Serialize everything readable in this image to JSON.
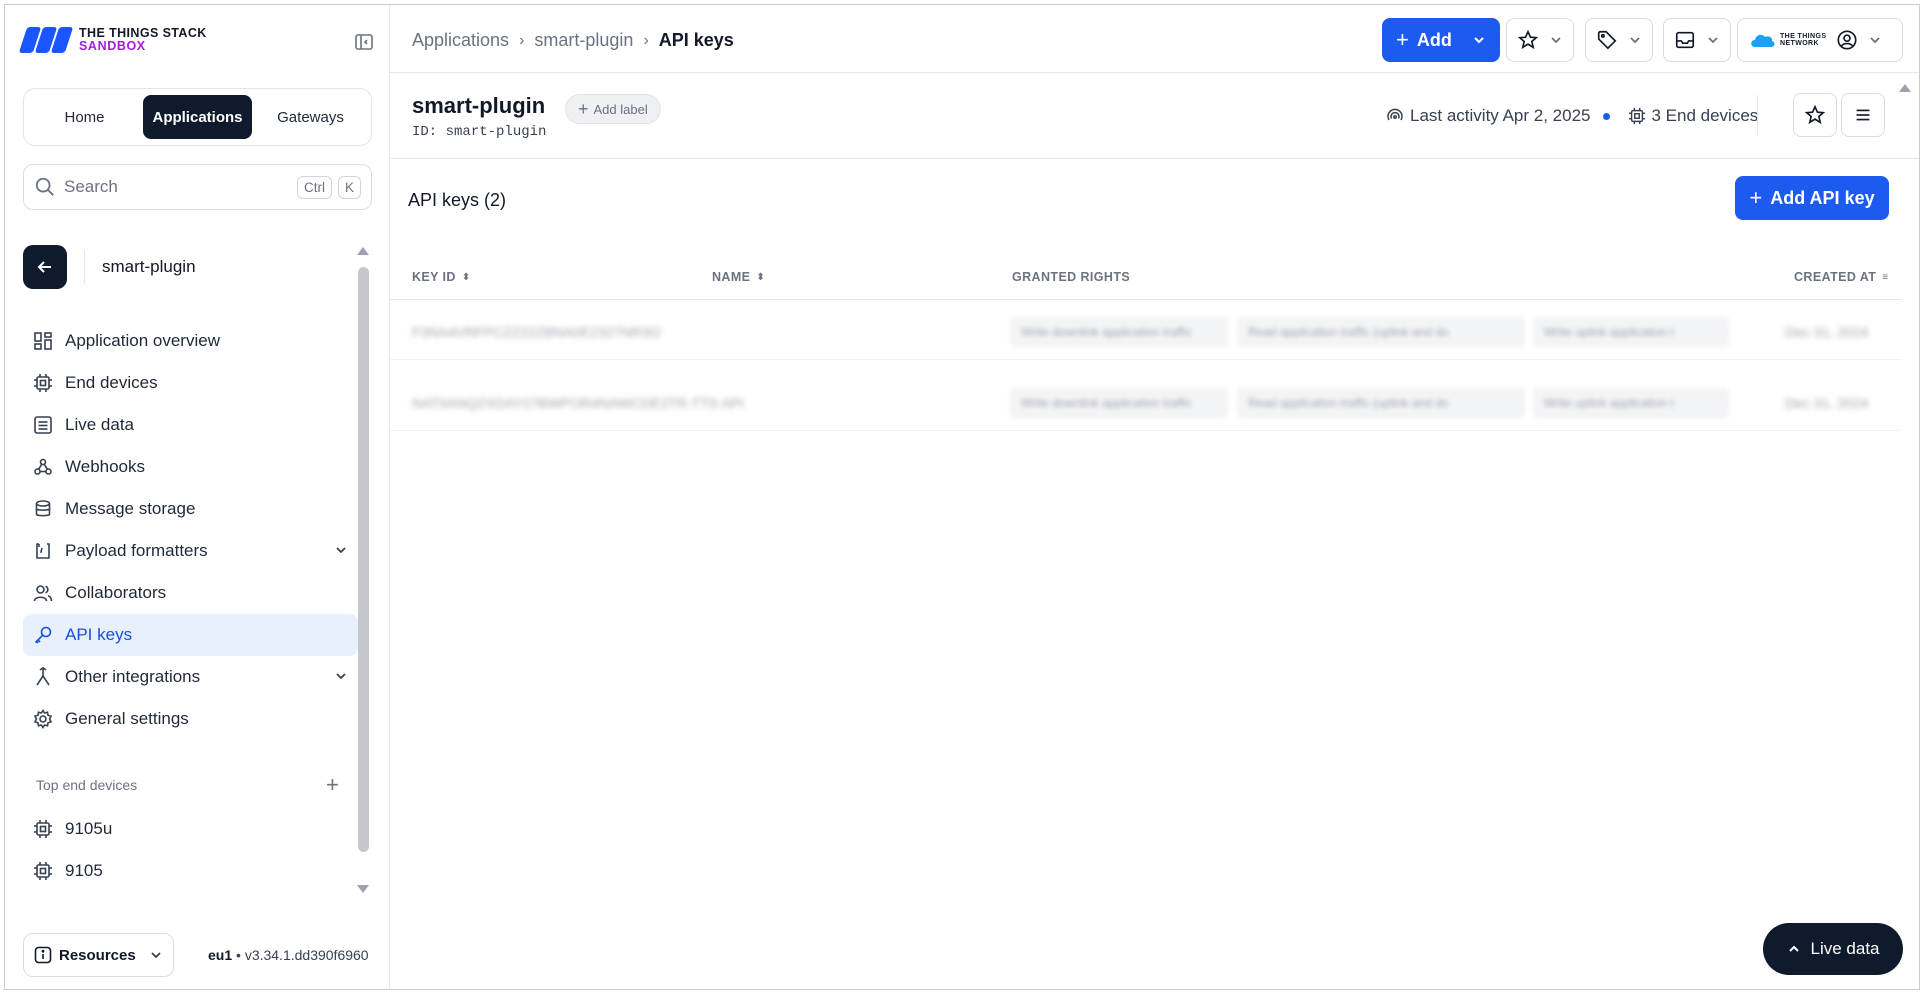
{
  "brand": {
    "line1": "THE THINGS STACK",
    "line2": "SANDBOX",
    "mark_color": "#1a56ff",
    "sandbox_color": "#a11fd6"
  },
  "top_nav": {
    "home": "Home",
    "applications": "Applications",
    "gateways": "Gateways",
    "active": "Applications"
  },
  "search": {
    "placeholder": "Search",
    "kbd1": "Ctrl",
    "kbd2": "K"
  },
  "app": {
    "name": "smart-plugin",
    "id_label": "ID:",
    "id_value": "smart-plugin",
    "add_label": "Add label"
  },
  "sidebar": {
    "items": [
      {
        "label": "Application overview",
        "icon": "grid-icon"
      },
      {
        "label": "End devices",
        "icon": "chip-icon"
      },
      {
        "label": "Live data",
        "icon": "list-icon"
      },
      {
        "label": "Webhooks",
        "icon": "webhook-icon"
      },
      {
        "label": "Message storage",
        "icon": "database-icon"
      },
      {
        "label": "Payload formatters",
        "icon": "code-icon",
        "expandable": true
      },
      {
        "label": "Collaborators",
        "icon": "users-icon"
      },
      {
        "label": "API keys",
        "icon": "key-icon",
        "active": true
      },
      {
        "label": "Other integrations",
        "icon": "branch-icon",
        "expandable": true
      },
      {
        "label": "General settings",
        "icon": "gear-icon"
      }
    ],
    "top_devices_title": "Top end devices",
    "devices": [
      "9105u",
      "9105"
    ],
    "resources": "Resources",
    "region": "eu1",
    "version": "v3.34.1.dd390f6960"
  },
  "breadcrumb": [
    "Applications",
    "smart-plugin",
    "API keys"
  ],
  "toolbar": {
    "add_label": "Add",
    "network_logo_line1": "THE THINGS",
    "network_logo_line2": "NETWORK",
    "accent": "#1d5bf0"
  },
  "header_meta": {
    "last_activity": "Last activity Apr 2, 2025",
    "end_devices": "3 End devices"
  },
  "api_keys": {
    "title": "API keys (2)",
    "add_button": "Add API key",
    "columns": [
      "KEY ID",
      "NAME",
      "GRANTED RIGHTS",
      "CREATED AT"
    ],
    "rows": [
      {
        "key_id": "F3NA4VRFPCZZ22ZBNA0E2327NR3I2",
        "name": "",
        "rights": [
          "Write downlink application traffic",
          "Read application traffic (uplink and do",
          "Write uplink application t"
        ],
        "created": "Dec 31, 2024"
      },
      {
        "key_id": "NAT0ANQZXDAY27BWPOR4NAWCDE2TR-TTS API",
        "name": "",
        "rights": [
          "Write downlink application traffic",
          "Read application traffic (uplink and do",
          "Write uplink application t"
        ],
        "created": "Dec 31, 2024"
      }
    ]
  },
  "live_data_button": "Live data"
}
